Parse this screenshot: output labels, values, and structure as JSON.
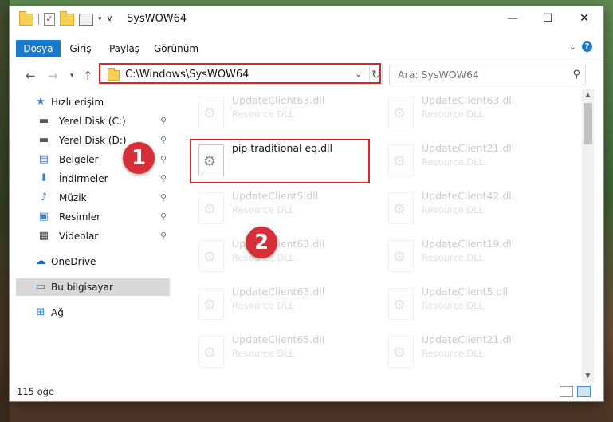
{
  "window": {
    "title": "SysWOW64",
    "controls": {
      "minimize": "—",
      "maximize": "☐",
      "close": "✕"
    }
  },
  "ribbon": {
    "tabs": [
      "Dosya",
      "Giriş",
      "Paylaş",
      "Görünüm"
    ],
    "active_tab": "Dosya",
    "help_label": "?"
  },
  "nav": {
    "address": "C:\\Windows\\SysWOW64",
    "search_placeholder": "Ara: SysWOW64"
  },
  "sidebar": {
    "items": [
      {
        "label": "Hızlı erişim",
        "icon": "star-icon",
        "pinned": false
      },
      {
        "label": "Yerel Disk (C:)",
        "icon": "drive-icon",
        "pinned": true
      },
      {
        "label": "Yerel Disk (D:)",
        "icon": "drive-icon",
        "pinned": true
      },
      {
        "label": "Belgeler",
        "icon": "document-icon",
        "pinned": true
      },
      {
        "label": "İndirmeler",
        "icon": "download-icon",
        "pinned": true
      },
      {
        "label": "Müzik",
        "icon": "music-icon",
        "pinned": true
      },
      {
        "label": "Resimler",
        "icon": "image-icon",
        "pinned": true
      },
      {
        "label": "Videolar",
        "icon": "video-icon",
        "pinned": true
      },
      {
        "label": "OneDrive",
        "icon": "cloud-icon",
        "pinned": false
      },
      {
        "label": "Bu bilgisayar",
        "icon": "computer-icon",
        "pinned": false,
        "selected": true
      },
      {
        "label": "Ağ",
        "icon": "network-icon",
        "pinned": false
      }
    ]
  },
  "files": {
    "left_column": [
      {
        "name": "UpdateClient63.dll",
        "type": "Resource DLL",
        "faded": true
      },
      {
        "name": "pip traditional eq.dll",
        "type": "",
        "faded": false,
        "highlighted": true
      },
      {
        "name": "UpdateClient5.dll",
        "type": "Resource DLL",
        "faded": true
      },
      {
        "name": "UpdateClient63.dll",
        "type": "Resource DLL",
        "faded": true
      },
      {
        "name": "UpdateClient63.dll",
        "type": "Resource DLL",
        "faded": true
      },
      {
        "name": "UpdateClient65.dll",
        "type": "Resource DLL",
        "faded": true
      }
    ],
    "right_column": [
      {
        "name": "UpdateClient63.dll",
        "type": "Resource DLL",
        "faded": true
      },
      {
        "name": "UpdateClient21.dll",
        "type": "Resource DLL",
        "faded": true
      },
      {
        "name": "UpdateClient42.dll",
        "type": "Resource DLL",
        "faded": true
      },
      {
        "name": "UpdateClient19.dll",
        "type": "Resource DLL",
        "faded": true
      },
      {
        "name": "UpdateClient5.dll",
        "type": "Resource DLL",
        "faded": true
      },
      {
        "name": "UpdateClient21.dll",
        "type": "Resource DLL",
        "faded": true
      }
    ]
  },
  "status": {
    "item_count": "115 öğe"
  },
  "annotations": {
    "badges": [
      "1",
      "2"
    ],
    "accent_color": "#d62f37"
  }
}
